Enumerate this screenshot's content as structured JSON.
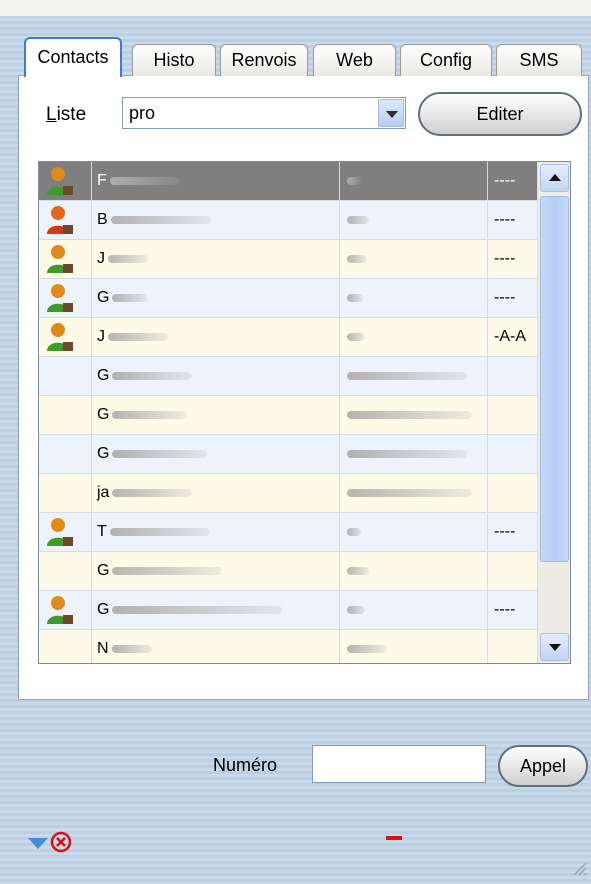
{
  "tabs": [
    {
      "label": "Contacts",
      "active": true
    },
    {
      "label": "Histo",
      "active": false
    },
    {
      "label": "Renvois",
      "active": false
    },
    {
      "label": "Web",
      "active": false
    },
    {
      "label": "Config",
      "active": false
    },
    {
      "label": "SMS",
      "active": false
    }
  ],
  "list": {
    "label_underlined": "L",
    "label_rest": "iste",
    "selected_value": "pro",
    "edit_button": "Editer"
  },
  "contacts": [
    {
      "initial": "F",
      "status": "----",
      "icon": "person-green",
      "selected": true
    },
    {
      "initial": "B",
      "status": "----",
      "icon": "person-red",
      "selected": false
    },
    {
      "initial": "J",
      "status": "----",
      "icon": "person-green",
      "selected": false
    },
    {
      "initial": "G",
      "status": "----",
      "icon": "person-green",
      "selected": false
    },
    {
      "initial": "J",
      "status": "-A-A",
      "icon": "person-green",
      "selected": false
    },
    {
      "initial": "G",
      "status": "",
      "icon": "",
      "selected": false
    },
    {
      "initial": "G",
      "status": "",
      "icon": "",
      "selected": false
    },
    {
      "initial": "G",
      "status": "",
      "icon": "",
      "selected": false
    },
    {
      "initial": "ja",
      "status": "",
      "icon": "",
      "selected": false
    },
    {
      "initial": "T",
      "status": "----",
      "icon": "person-green",
      "selected": false
    },
    {
      "initial": "G",
      "status": "",
      "icon": "",
      "selected": false
    },
    {
      "initial": "G",
      "status": "----",
      "icon": "person-green",
      "selected": false
    },
    {
      "initial": "N",
      "status": "",
      "icon": "",
      "selected": false
    }
  ],
  "dial": {
    "numero_label": "Numéro",
    "numero_value": "",
    "appel_button": "Appel"
  },
  "colors": {
    "accent": "#3b7bd1",
    "selection": "#7f7f7f",
    "row_even": "#edf3fa",
    "row_odd": "#fdfbe8",
    "status_red": "#e01010"
  }
}
